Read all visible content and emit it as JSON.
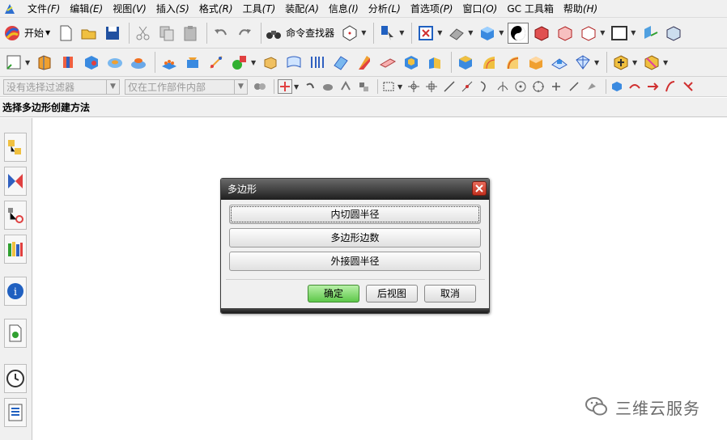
{
  "menubar": {
    "items": [
      {
        "label": "文件",
        "accel": "(F)"
      },
      {
        "label": "编辑",
        "accel": "(E)"
      },
      {
        "label": "视图",
        "accel": "(V)"
      },
      {
        "label": "插入",
        "accel": "(S)"
      },
      {
        "label": "格式",
        "accel": "(R)"
      },
      {
        "label": "工具",
        "accel": "(T)"
      },
      {
        "label": "装配",
        "accel": "(A)"
      },
      {
        "label": "信息",
        "accel": "(I)"
      },
      {
        "label": "分析",
        "accel": "(L)"
      },
      {
        "label": "首选项",
        "accel": "(P)"
      },
      {
        "label": "窗口",
        "accel": "(O)"
      },
      {
        "label": "GC 工具箱",
        "accel": ""
      },
      {
        "label": "帮助",
        "accel": "(H)"
      }
    ]
  },
  "toolbar": {
    "start_label": "开始",
    "command_finder_label": "命令查找器"
  },
  "selection_bar": {
    "filter_placeholder": "没有选择过滤器",
    "scope_value": "仅在工作部件内部"
  },
  "cue_line": {
    "text": "选择多边形创建方法"
  },
  "dialog": {
    "title": "多边形",
    "options": [
      {
        "label": "内切圆半径"
      },
      {
        "label": "多边形边数"
      },
      {
        "label": "外接圆半径"
      }
    ],
    "ok_label": "确定",
    "back_label": "后视图",
    "cancel_label": "取消"
  },
  "watermark": {
    "text": "三维云服务"
  },
  "colors": {
    "ok_button": "#5ec84a",
    "close_button": "#c2311f",
    "title_bar": "#1e1e1e"
  }
}
